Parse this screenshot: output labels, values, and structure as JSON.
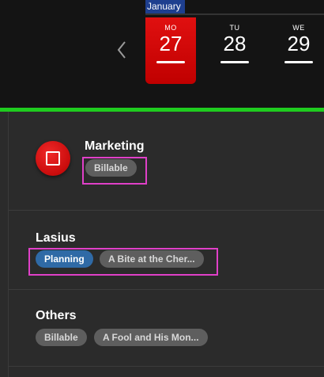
{
  "calendar": {
    "month": "January",
    "days": [
      {
        "dow": "MO",
        "num": "27",
        "active": true
      },
      {
        "dow": "TU",
        "num": "28",
        "active": false
      },
      {
        "dow": "WE",
        "num": "29",
        "active": false
      }
    ]
  },
  "projects": [
    {
      "name": "Marketing",
      "tags": [
        "Billable"
      ]
    },
    {
      "name": "Lasius",
      "tags": [
        "Planning",
        "A Bite at the Cher..."
      ]
    },
    {
      "name": "Others",
      "tags": [
        "Billable",
        "A Fool and His Mon..."
      ]
    }
  ],
  "colors": {
    "accent_red": "#d80000",
    "accent_green": "#1fcc1f",
    "tag_blue": "#2f6aa6",
    "tag_gray": "#5e5e5e",
    "highlight": "#e040c8"
  }
}
